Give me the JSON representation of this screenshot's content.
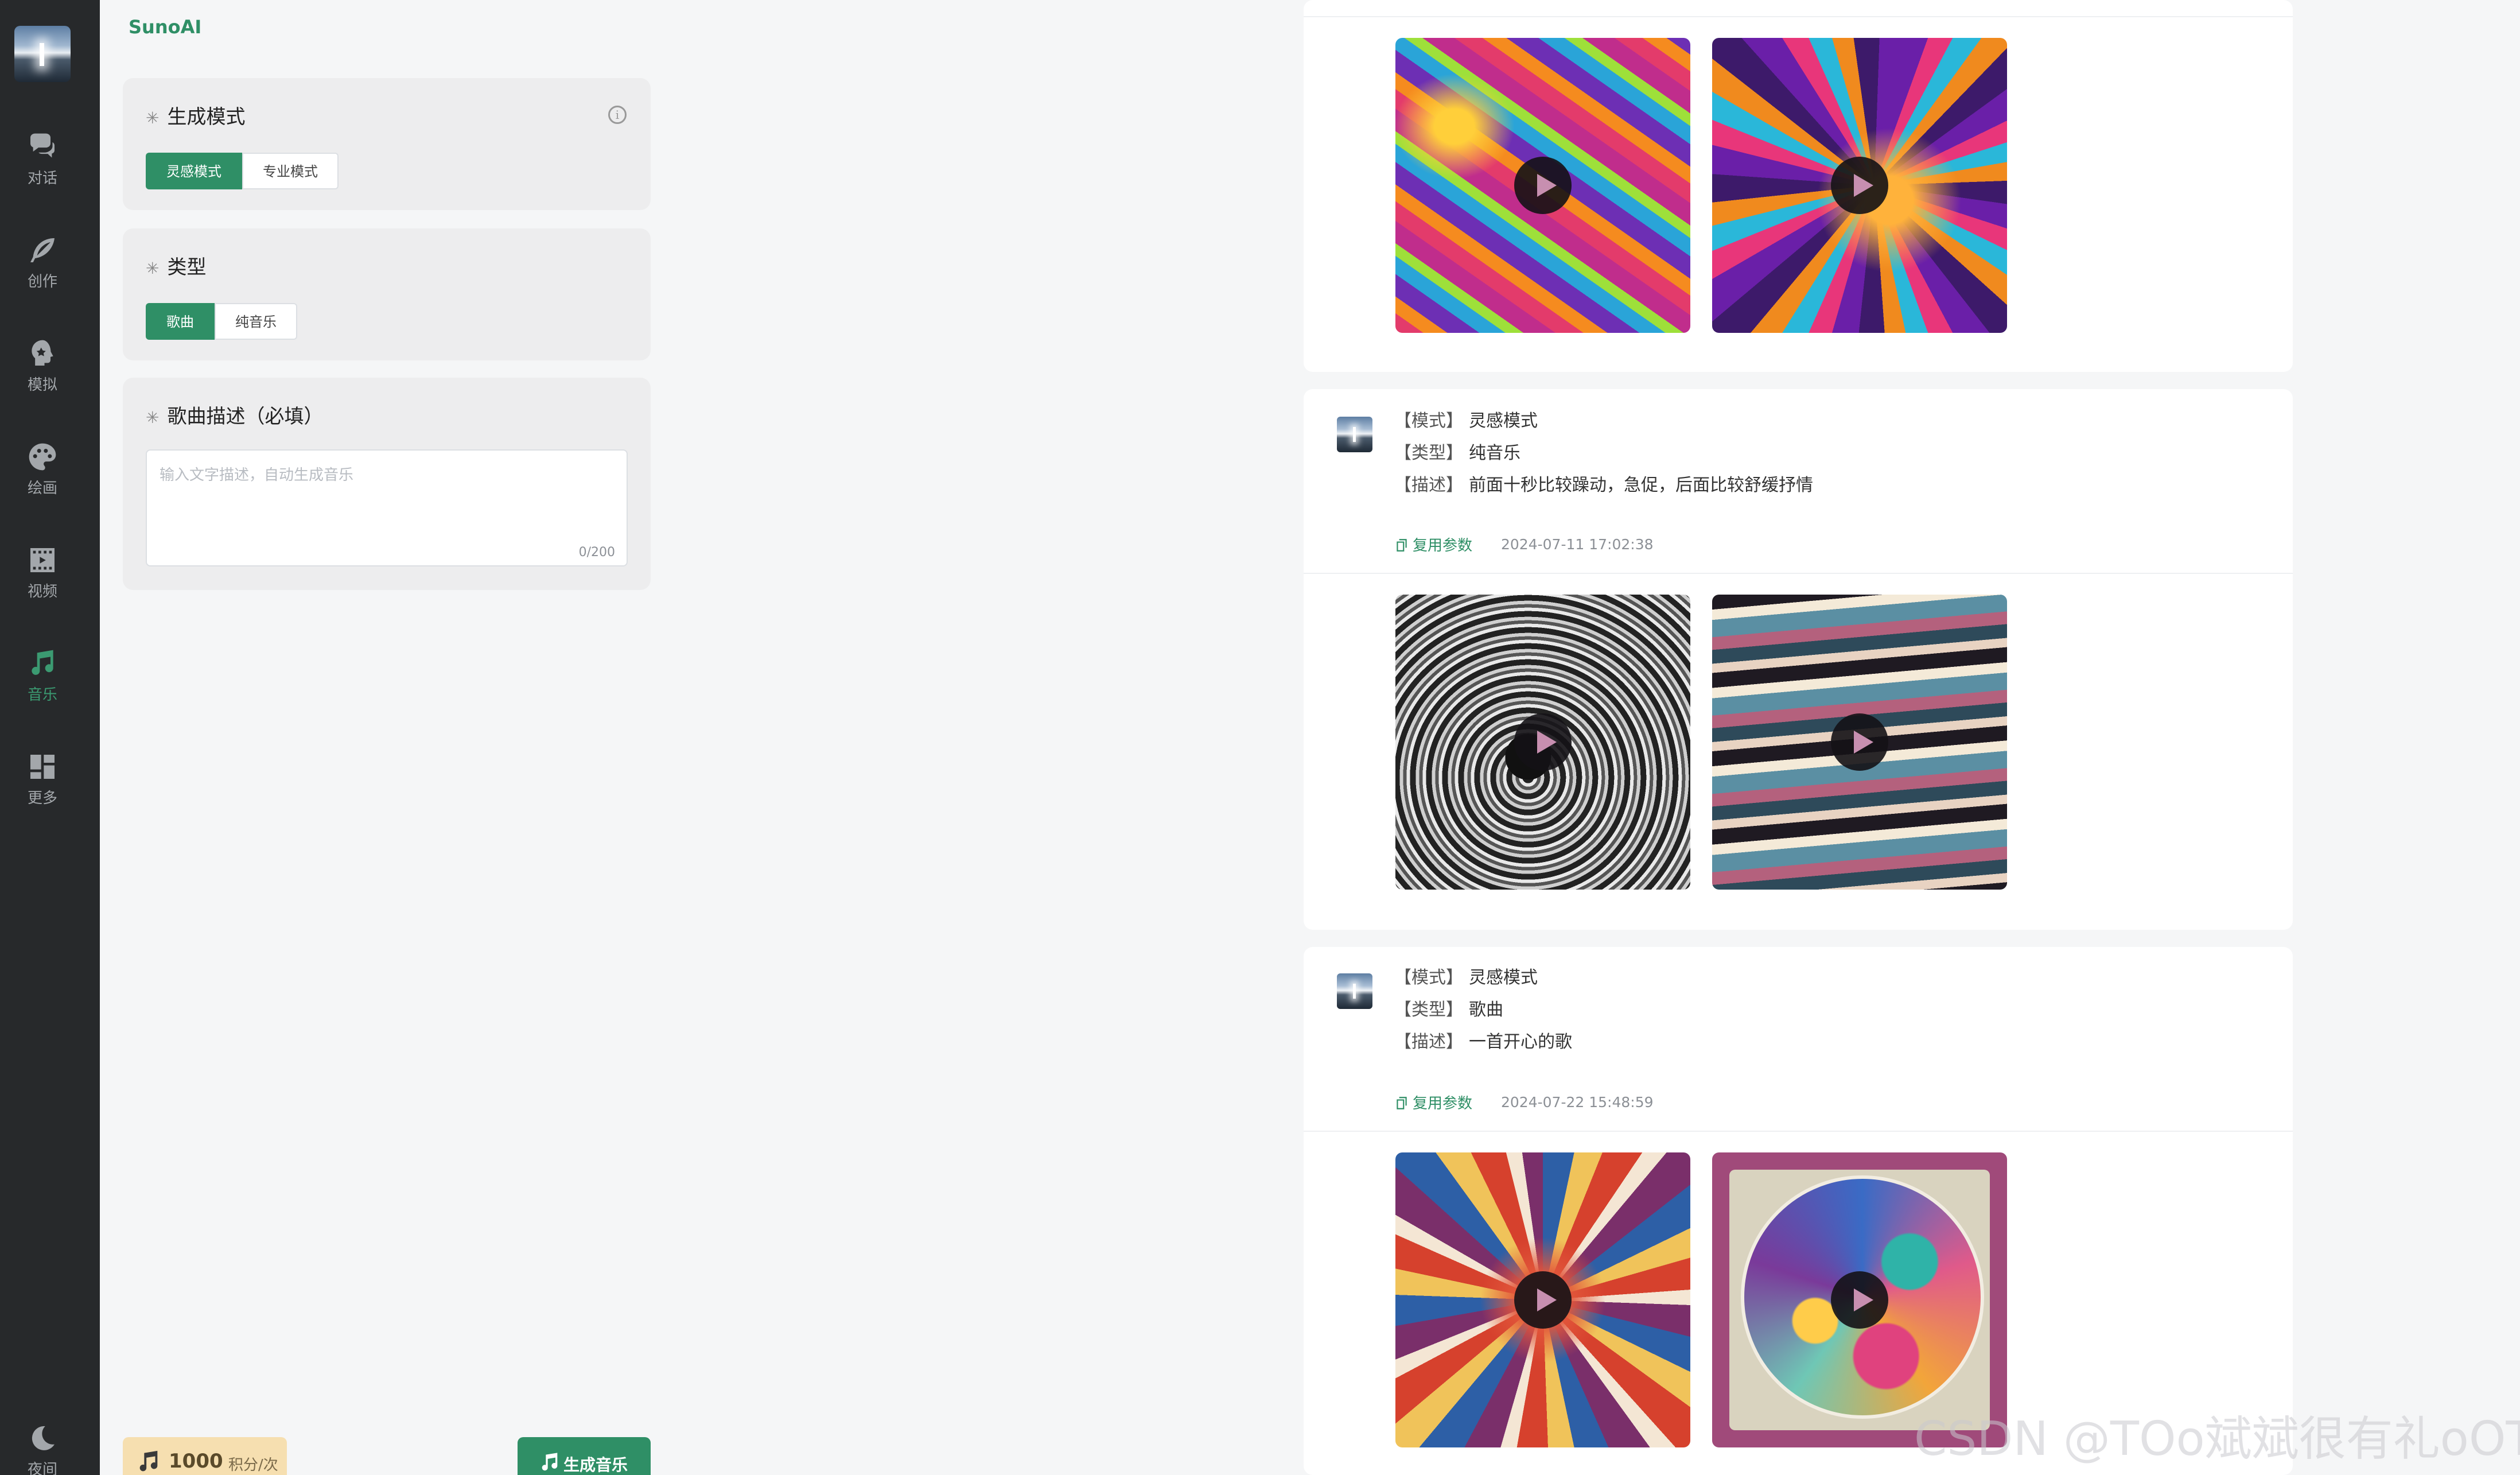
{
  "sidebar": {
    "nav": [
      {
        "label": "对话",
        "icon": "chat-icon"
      },
      {
        "label": "创作",
        "icon": "feather-icon"
      },
      {
        "label": "模拟",
        "icon": "head-icon"
      },
      {
        "label": "绘画",
        "icon": "palette-icon"
      },
      {
        "label": "视频",
        "icon": "video-icon"
      },
      {
        "label": "音乐",
        "icon": "music-icon",
        "active": true
      },
      {
        "label": "更多",
        "icon": "grid-icon"
      },
      {
        "label": "夜间",
        "icon": "moon-icon"
      }
    ],
    "accent": "#3b9a71"
  },
  "panel": {
    "tab_label": "SunoAI",
    "mode": {
      "title": "生成模式",
      "options": [
        "灵感模式",
        "专业模式"
      ],
      "selected": "灵感模式"
    },
    "type": {
      "title": "类型",
      "options": [
        "歌曲",
        "纯音乐"
      ],
      "selected": "歌曲"
    },
    "description": {
      "title": "歌曲描述（必填）",
      "placeholder": "输入文字描述，自动生成音乐",
      "counter": "0/200"
    },
    "cost": {
      "value": "1000",
      "unit": "积分/次"
    },
    "generate_label": "生成音乐"
  },
  "feed": {
    "labels": {
      "mode": "【模式】",
      "type": "【类型】",
      "desc": "【描述】",
      "reuse": "复用参数"
    },
    "posts": [
      {
        "mode": "灵感模式",
        "type": "纯音乐",
        "desc": "前面十秒比较躁动，急促，后面比较舒缓抒情",
        "time": "2024-07-11 17:02:38"
      },
      {
        "mode": "灵感模式",
        "type": "歌曲",
        "desc": "一首开心的歌",
        "time": "2024-07-22 15:48:59"
      }
    ]
  },
  "watermark": "CSDN @TOo斌斌很有礼oOT"
}
